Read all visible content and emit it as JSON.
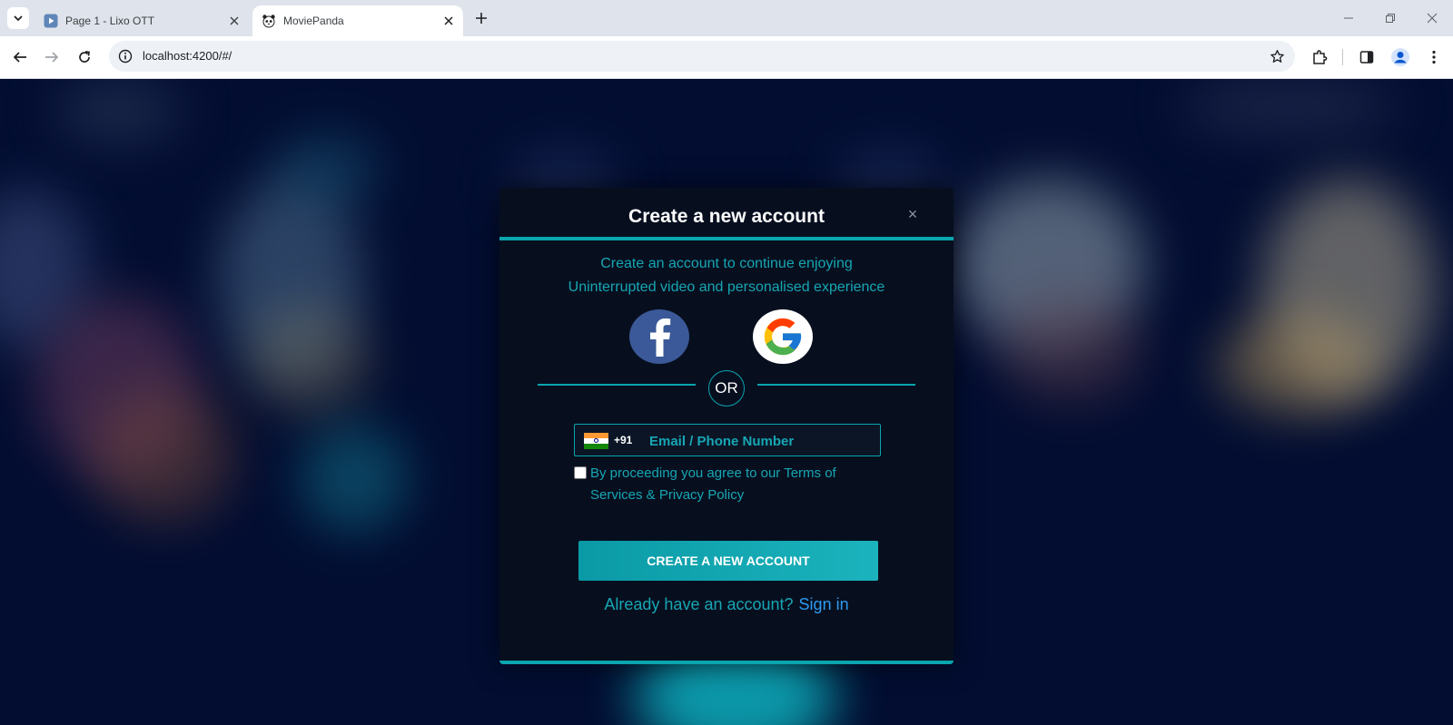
{
  "browser": {
    "tabs": [
      {
        "title": "Page 1 - Lixo OTT",
        "favicon": "play-icon",
        "active": false
      },
      {
        "title": "MoviePanda",
        "favicon": "panda-icon",
        "active": true
      }
    ],
    "url": "localhost:4200/#/"
  },
  "modal": {
    "title": "Create a new account",
    "close_label": "×",
    "subtitle_line1": "Create an account to continue enjoying",
    "subtitle_line2": "Uninterrupted video and personalised experience",
    "social": [
      {
        "name": "facebook",
        "icon": "facebook-icon",
        "color": "#3b5998"
      },
      {
        "name": "google",
        "icon": "google-icon",
        "color": "#ffffff"
      }
    ],
    "or_label": "OR",
    "country_code": "+91",
    "country_flag": "india-flag-icon",
    "phone_placeholder": "Email / Phone Number",
    "terms_text": "By proceeding you agree to our Terms of Services & Privacy Policy",
    "terms_checked": false,
    "create_button": "CREATE A NEW ACCOUNT",
    "signin_question": "Already have an account?",
    "signin_link": "Sign in"
  },
  "colors": {
    "accent": "#0aa5ae",
    "accent_text": "#17a6b3",
    "link": "#2d9bf0",
    "modal_bg": "#070f1f",
    "page_bg": "#020d31"
  }
}
